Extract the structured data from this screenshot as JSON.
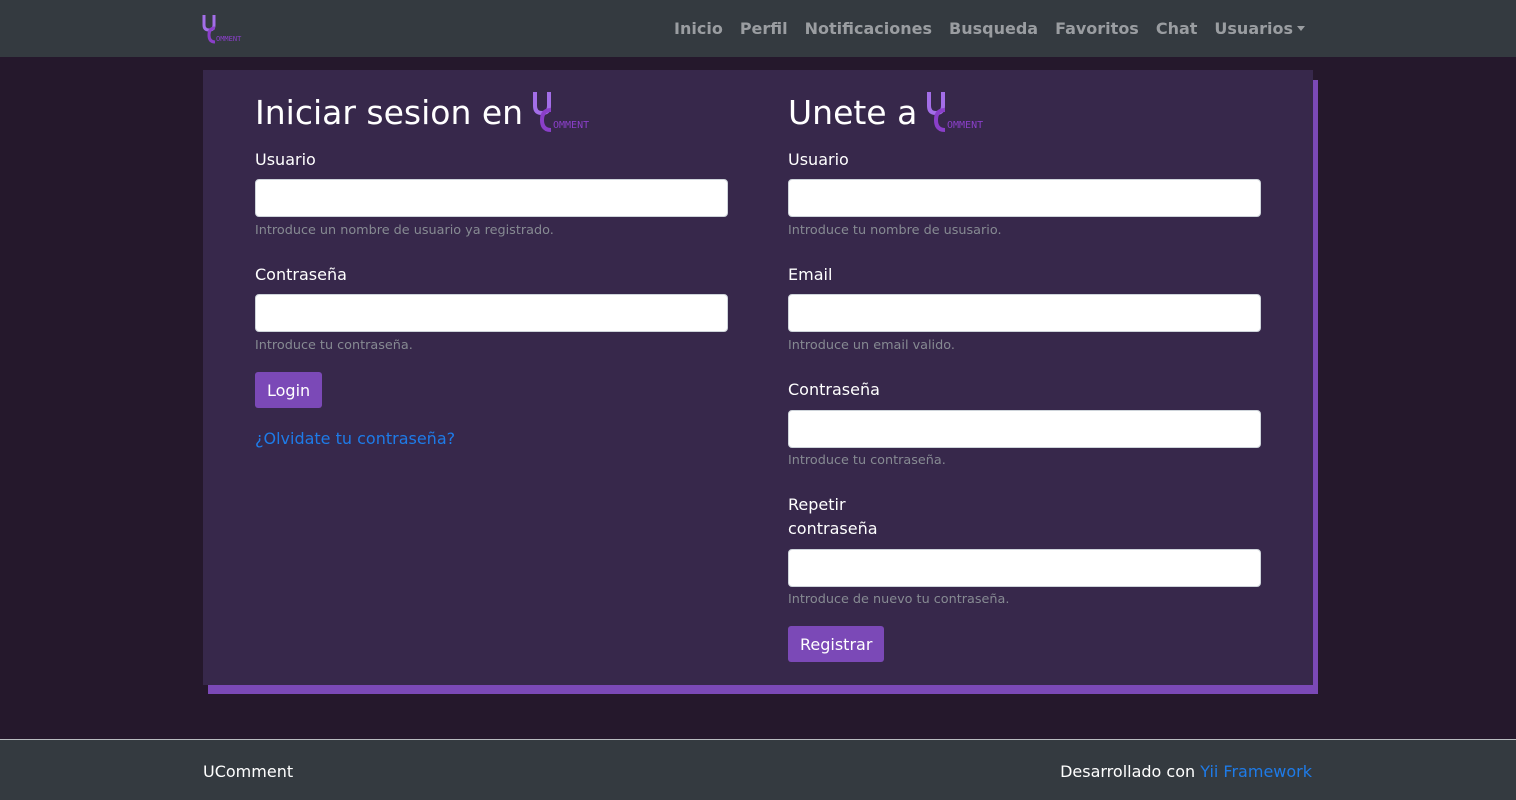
{
  "nav": {
    "brand": "UComment",
    "items": [
      {
        "label": "Inicio"
      },
      {
        "label": "Perfil"
      },
      {
        "label": "Notificaciones"
      },
      {
        "label": "Busqueda"
      },
      {
        "label": "Favoritos"
      },
      {
        "label": "Chat"
      },
      {
        "label": "Usuarios"
      }
    ]
  },
  "login": {
    "heading": "Iniciar sesion en",
    "username_label": "Usuario",
    "username_value": "",
    "username_hint": "Introduce un nombre de usuario ya registrado.",
    "password_label": "Contraseña",
    "password_value": "",
    "password_hint": "Introduce tu contraseña.",
    "submit_label": "Login",
    "forgot_link": "¿Olvidate tu contraseña?"
  },
  "register": {
    "heading": "Unete a",
    "username_label": "Usuario",
    "username_value": "",
    "username_hint": "Introduce tu nombre de ususario.",
    "email_label": "Email",
    "email_value": "",
    "email_hint": "Introduce un email valido.",
    "password_label": "Contraseña",
    "password_value": "",
    "password_hint": "Introduce tu contraseña.",
    "repeat_label_line1": "Repetir",
    "repeat_label_line2": "contraseña",
    "repeat_value": "",
    "repeat_hint": "Introduce de nuevo tu contraseña.",
    "submit_label": "Registrar"
  },
  "footer": {
    "brand": "UComment",
    "credits_prefix": "Desarrollado con",
    "credits_link": "Yii Framework"
  },
  "colors": {
    "accent": "#7b49b7",
    "page_bg": "#25182c",
    "card_bg": "#37284b",
    "navbar_bg": "#343a40",
    "link": "#1e7be8"
  }
}
